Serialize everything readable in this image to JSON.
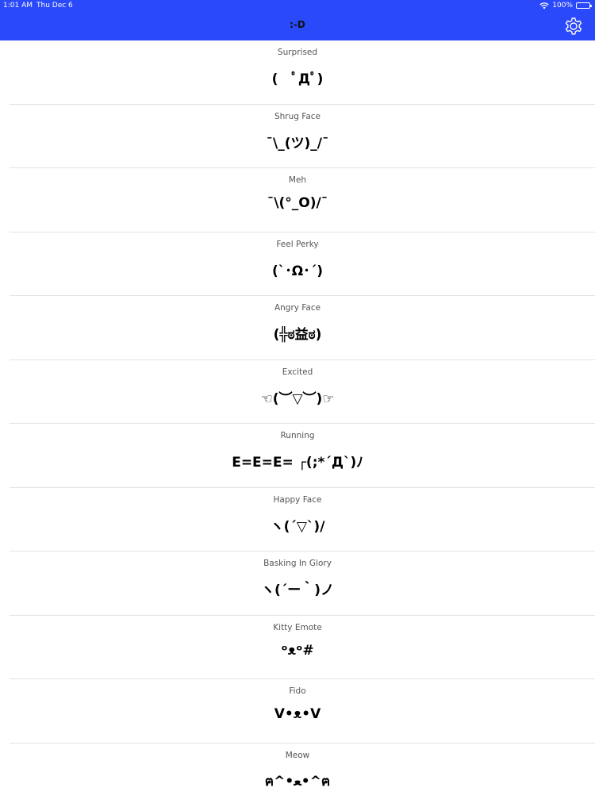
{
  "status_bar": {
    "time": "1:01 AM",
    "date": "Thu Dec 6",
    "battery": "100%"
  },
  "nav": {
    "title": ":-D"
  },
  "colors": {
    "accent": "#2a49fa",
    "separator": "#e3e3e3"
  },
  "icons": {
    "settings": "gear-icon",
    "wifi": "wifi-icon",
    "battery": "battery-icon"
  },
  "emotes": [
    {
      "label": "Surprised",
      "face": "(　ﾟДﾟ)"
    },
    {
      "label": "Shrug Face",
      "face": "¯\\_(ツ)_/¯"
    },
    {
      "label": "Meh",
      "face": "¯\\(°_O)/¯"
    },
    {
      "label": "Feel Perky",
      "face": "(`･Ω･´)"
    },
    {
      "label": "Angry Face",
      "face": "(╬ಠ益ಠ)"
    },
    {
      "label": "Excited",
      "face": "☜(︶▽︶)☞"
    },
    {
      "label": "Running",
      "face": "E=E=E= ┌(;*´Д`)ﾉ"
    },
    {
      "label": "Happy Face",
      "face": "ヽ(´▽`)/"
    },
    {
      "label": "Basking In Glory",
      "face": "ヽ(´ー｀)ノ"
    },
    {
      "label": "Kitty Emote",
      "face": "ᵒᴥᵒ#"
    },
    {
      "label": "Fido",
      "face": "V•ᴥ•V"
    },
    {
      "label": "Meow",
      "face": "ฅ^•ﻌ•^ฅ"
    }
  ]
}
